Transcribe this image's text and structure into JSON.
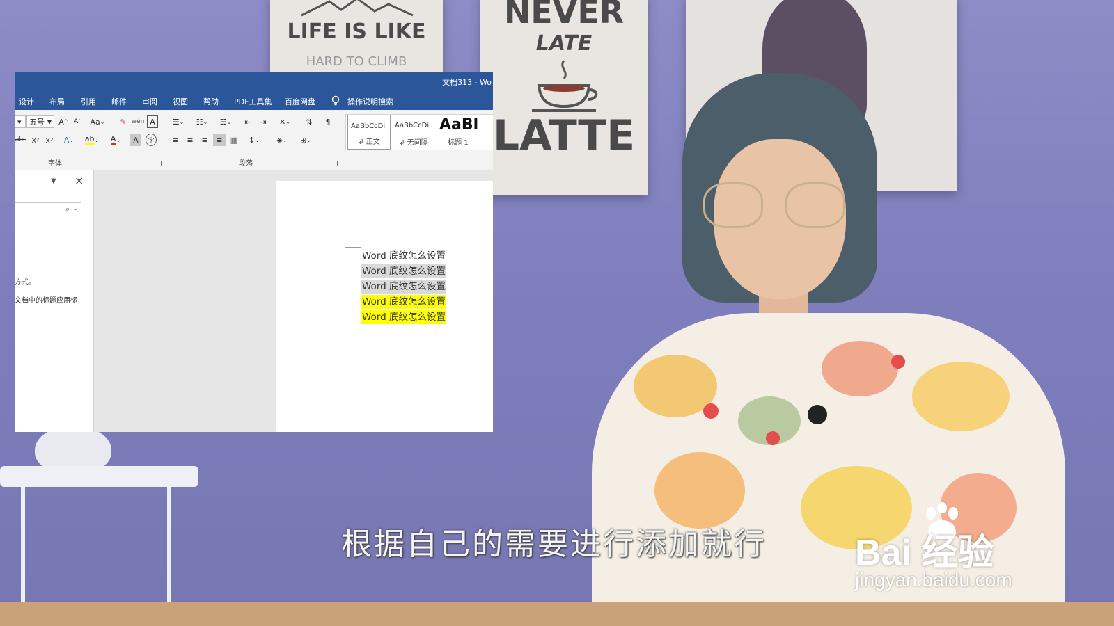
{
  "window": {
    "title": "文档313  -  Wo"
  },
  "tabs": [
    "设计",
    "布局",
    "引用",
    "邮件",
    "审阅",
    "视图",
    "帮助",
    "PDF工具集",
    "百度网盘"
  ],
  "tell_me": "操作说明搜索",
  "ribbon": {
    "font_size": "五号",
    "font_group_label": "字体",
    "paragraph_group_label": "段落",
    "change_case": "Aa",
    "styles": [
      {
        "sample": "AaBbCcDi",
        "name": "↲ 正文"
      },
      {
        "sample": "AaBbCcDi",
        "name": "↲ 无间隔"
      },
      {
        "sample": "AaBl",
        "name": "标题 1"
      }
    ]
  },
  "nav": {
    "close": "×",
    "text1": "方式。",
    "text2": "文档中的标题应用标"
  },
  "document": {
    "lines": [
      {
        "text": "Word 底纹怎么设置",
        "shading": "none"
      },
      {
        "text": "Word 底纹怎么设置",
        "shading": "#d9d9d9"
      },
      {
        "text": "Word 底纹怎么设置",
        "shading": "#d9d9d9"
      },
      {
        "text": "Word 底纹怎么设置",
        "shading": "#ffff00"
      },
      {
        "text": "Word 底纹怎么设置",
        "shading": "#ffff00"
      }
    ]
  },
  "background": {
    "poster_life": {
      "line1": "LIFE IS LIKE",
      "line2": "HARD TO CLIMB"
    },
    "poster_never": {
      "line1": "NEVER",
      "line2": "LATE",
      "line3": "LATTE"
    }
  },
  "subtitle": "根据自己的需要进行添加就行",
  "watermark": {
    "logo": "Bai  经验",
    "url": "jingyan.baidu.com"
  },
  "colors": {
    "word_blue": "#2b579a",
    "highlight_yellow": "#ffff00",
    "shade_gray": "#d9d9d9"
  }
}
